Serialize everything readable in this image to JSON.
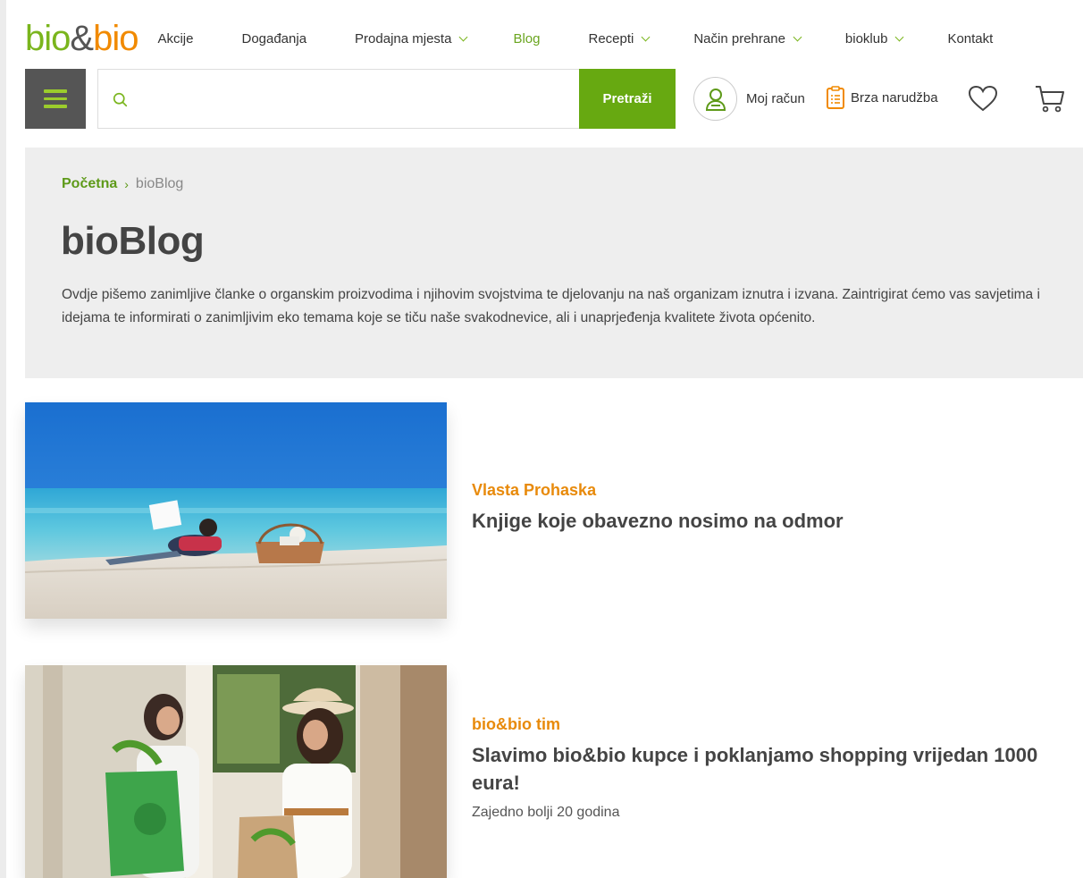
{
  "header": {
    "logo": {
      "part1": "bio",
      "amp": "&",
      "part2": "bio"
    },
    "nav": [
      {
        "label": "Akcije",
        "dropdown": false,
        "active": false
      },
      {
        "label": "Događanja",
        "dropdown": false,
        "active": false
      },
      {
        "label": "Prodajna mjesta",
        "dropdown": true,
        "active": false
      },
      {
        "label": "Blog",
        "dropdown": false,
        "active": true
      },
      {
        "label": "Recepti",
        "dropdown": true,
        "active": false
      },
      {
        "label": "Način prehrane",
        "dropdown": true,
        "active": false
      },
      {
        "label": "bioklub",
        "dropdown": true,
        "active": false
      },
      {
        "label": "Kontakt",
        "dropdown": false,
        "active": false
      }
    ],
    "search": {
      "placeholder": "",
      "value": "",
      "button_label": "Pretraži"
    },
    "account_label": "Moj račun",
    "quick_order_label": "Brza narudžba",
    "colors": {
      "brand_green": "#7ab51d",
      "brand_orange": "#f18a00",
      "button_green": "#67a911",
      "menu_dark": "#555555"
    }
  },
  "hero": {
    "breadcrumb": {
      "home": "Početna",
      "separator": "›",
      "current": "bioBlog"
    },
    "title": "bioBlog",
    "description": "Ovdje pišemo zanimljive članke o organskim proizvodima i njihovim svojstvima te djelovanju na naš organizam iznutra i izvana. Zaintrigirat ćemo vas savjetima i idejama te informirati o zanimljivim eko temama koje se tiču naše svakodnevice, ali i unaprjeđenja kvalitete života općenito."
  },
  "articles": [
    {
      "author": "Vlasta Prohaska",
      "title": "Knjige koje obavezno nosimo na odmor",
      "subtitle": ""
    },
    {
      "author": "bio&bio tim",
      "title": "Slavimo bio&bio kupce i poklanjamo shopping vrijedan 1000 eura!",
      "subtitle": "Zajedno bolji 20 godina"
    }
  ]
}
